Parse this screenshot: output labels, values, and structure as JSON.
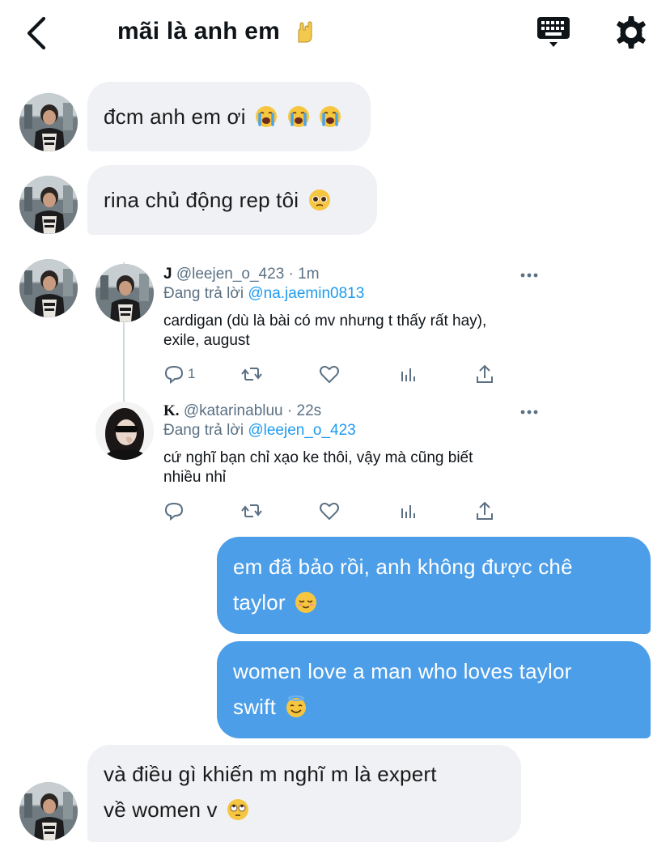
{
  "header": {
    "title": "mãi là anh em",
    "icons": {
      "back": "chevron-left-icon",
      "keyboard": "keyboard-icon",
      "settings": "gear-icon"
    }
  },
  "messages": [
    {
      "id": "m1",
      "direction": "in",
      "text": "đcm anh em ơi",
      "emoji": [
        "loudly-crying-face",
        "loudly-crying-face",
        "loudly-crying-face"
      ]
    },
    {
      "id": "m2",
      "direction": "in",
      "text": "rina chủ động rep tôi",
      "emoji": [
        "pleading-face"
      ]
    },
    {
      "id": "m4",
      "direction": "out",
      "lines": [
        "em đã bảo rồi, anh không được chê",
        "taylor"
      ],
      "emoji": [
        "relieved-face"
      ]
    },
    {
      "id": "m5",
      "direction": "out",
      "lines": [
        "women love a man who loves taylor",
        "swift"
      ],
      "emoji": [
        "smiling-face-with-halo"
      ]
    },
    {
      "id": "m6",
      "direction": "in",
      "lines": [
        "và điều gì khiến m nghĩ m là expert",
        "về women v"
      ],
      "emoji": [
        "face-with-rolling-eyes"
      ]
    }
  ],
  "shared_tweet": {
    "tweets": [
      {
        "name": "J",
        "handle": "@leejen_o_423",
        "time": "· 1m",
        "reply_prefix": "Đang trả lời",
        "reply_to": "@na.jaemin0813",
        "text_lines": [
          "cardigan (dù là bài có mv nhưng t thấy rất hay),",
          "exile, august"
        ],
        "reply_count": "1"
      },
      {
        "name": "K.",
        "handle": "@katarinabluu",
        "time": "· 22s",
        "reply_prefix": "Đang trả lời",
        "reply_to": "@leejen_o_423",
        "text_lines": [
          "cứ nghĩ bạn chỉ xạo ke thôi, vậy mà cũng biết",
          "nhiều nhỉ"
        ],
        "reply_count": ""
      }
    ]
  },
  "colors": {
    "incoming_bubble": "#eff1f4",
    "outgoing_bubble": "#4c9ee8",
    "mention": "#1d9bf0",
    "muted": "#5b7083"
  }
}
